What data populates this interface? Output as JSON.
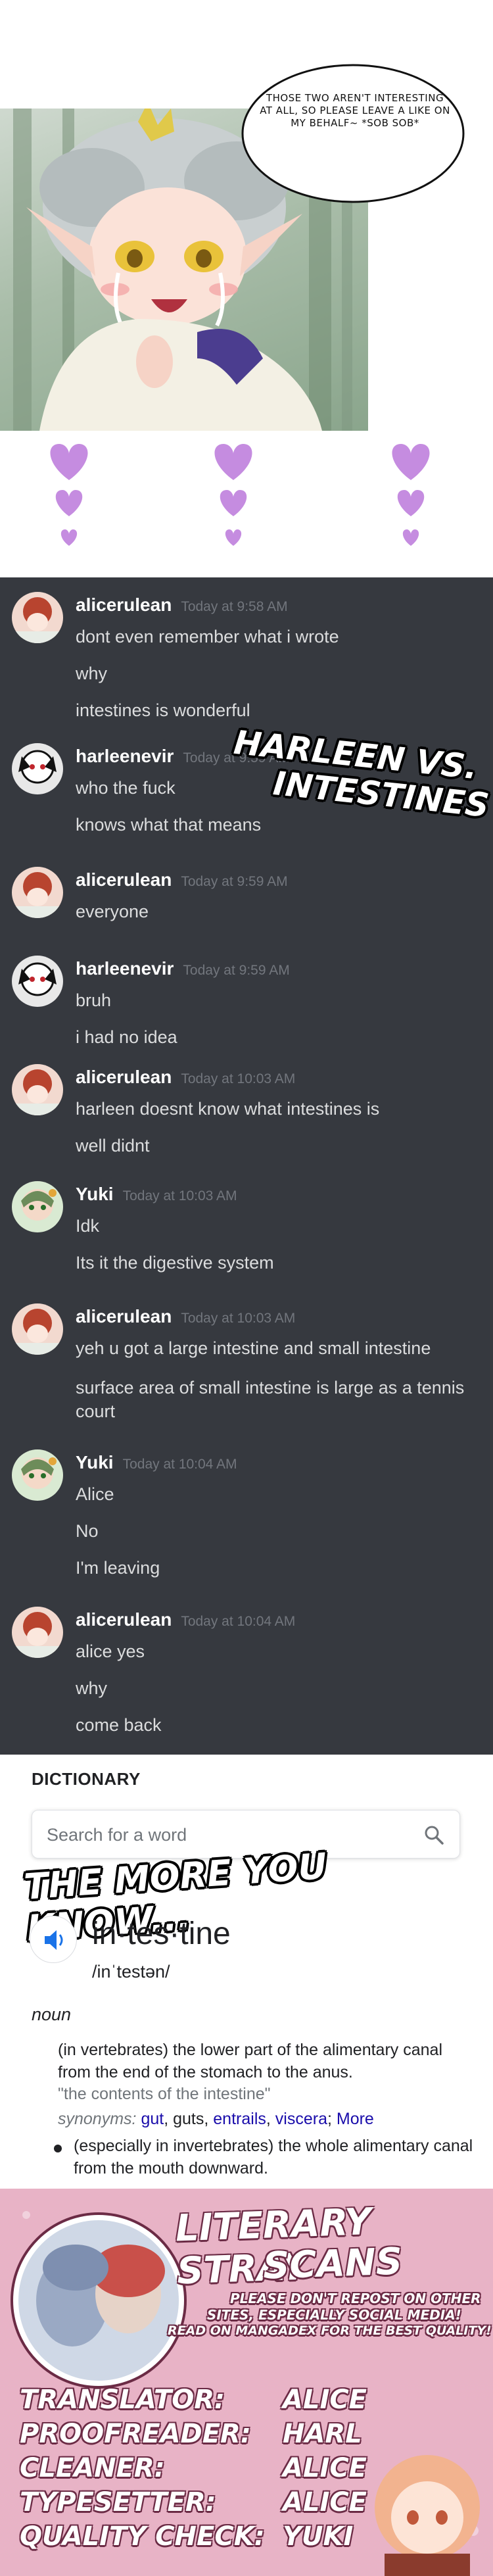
{
  "speech_bubble": {
    "text": "THOSE TWO AREN'T INTERESTING AT ALL, SO PLEASE LEAVE A LIKE ON MY BEHALF~ *SOB SOB*"
  },
  "chat": {
    "overlay_title": "HARLEEN VS. INTESTINES",
    "messages": [
      {
        "user": "alicerulean",
        "timestamp": "Today at 9:58 AM",
        "lines": [
          "dont even remember what i wrote",
          "why",
          "intestines is wonderful"
        ]
      },
      {
        "user": "harleenevir",
        "timestamp": "Today at 9:59 AM",
        "lines": [
          "who the fuck",
          "knows what that means"
        ]
      },
      {
        "user": "alicerulean",
        "timestamp": "Today at 9:59 AM",
        "lines": [
          "everyone"
        ]
      },
      {
        "user": "harleenevir",
        "timestamp": "Today at 9:59 AM",
        "lines": [
          "bruh",
          "i had no idea"
        ]
      },
      {
        "user": "alicerulean",
        "timestamp": "Today at 10:03 AM",
        "lines": [
          "harleen doesnt know what intestines is",
          "well didnt"
        ]
      },
      {
        "user": "Yuki",
        "timestamp": "Today at 10:03 AM",
        "lines": [
          "Idk",
          "Its it the digestive system"
        ]
      },
      {
        "user": "alicerulean",
        "timestamp": "Today at 10:03 AM",
        "lines": [
          "yeh u got a large intestine and small intestine",
          "surface area of small intestine is large as a tennis court"
        ]
      },
      {
        "user": "Yuki",
        "timestamp": "Today at 10:04 AM",
        "lines": [
          "Alice",
          "No",
          "I'm leaving"
        ]
      },
      {
        "user": "alicerulean",
        "timestamp": "Today at 10:04 AM",
        "lines": [
          "alice yes",
          "why",
          "come back"
        ]
      }
    ]
  },
  "dictionary": {
    "header": "DICTIONARY",
    "search_placeholder": "Search for a word",
    "overlay_caption": "THE MORE YOU KNOW...",
    "word": "in·tes·tine",
    "phonetic": "/inˈtestən/",
    "part_of_speech": "noun",
    "definition_1": "(in vertebrates) the lower part of the alimentary canal from the end of the stomach to the anus.",
    "example_1": "\"the contents of the intestine\"",
    "synonyms_label": "synonyms:",
    "synonyms": [
      "gut",
      "guts",
      "entrails",
      "viscera"
    ],
    "synonyms_more": "More",
    "definition_2": "(especially in invertebrates) the whole alimentary canal from the mouth downward."
  },
  "credits": {
    "group_name_line1": "LITERARY STRAY",
    "group_name_line2": "SCANS",
    "notice_line1": "PLEASE DON'T REPOST ON OTHER",
    "notice_line2": "SITES, ESPECIALLY SOCIAL MEDIA!",
    "notice_line3": "READ ON MANGADEX FOR THE BEST QUALITY!",
    "roles": [
      {
        "role": "TRANSLATOR:",
        "name": "ALICE"
      },
      {
        "role": "PROOFREADER:",
        "name": "HARL"
      },
      {
        "role": "CLEANER:",
        "name": "ALICE"
      },
      {
        "role": "TYPESETTER:",
        "name": "ALICE"
      },
      {
        "role": "QUALITY CHECK:",
        "name": "YUKI"
      }
    ]
  },
  "colors": {
    "chat_bg": "#36393f",
    "username": "#ffffff",
    "timestamp": "#72767d",
    "message_text": "#dcddde",
    "heart": "#c58ce0",
    "link": "#1a0dab",
    "speaker_blue": "#1a73e8",
    "credits_bg": "#e8b3c6"
  }
}
